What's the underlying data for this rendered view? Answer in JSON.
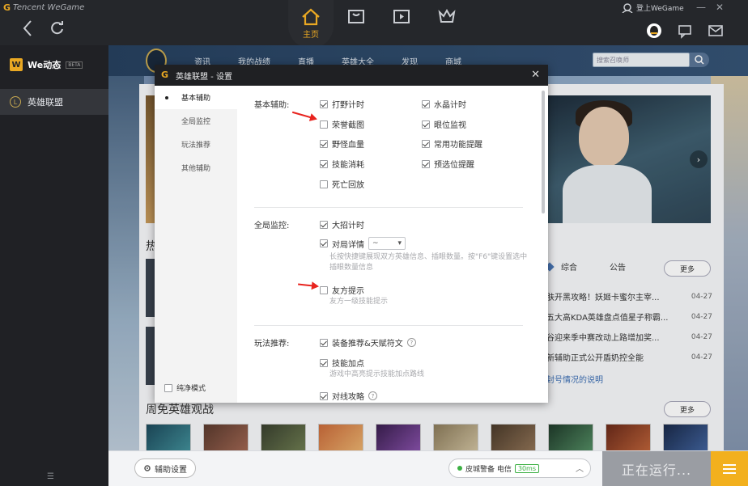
{
  "app": {
    "brand_text": "Tencent WeGame",
    "nav_home_label": "主页",
    "login_text": "登上WeGame",
    "win_controls": [
      "—",
      "✕"
    ]
  },
  "sidebar": {
    "we_title": "We动态",
    "we_badge": "BETA",
    "lol_label": "英雄联盟",
    "footer_glyph": "☰"
  },
  "game_page": {
    "tabs": [
      "资讯",
      "我的战绩",
      "直播",
      "英雄大全",
      "发现",
      "商城"
    ],
    "search_placeholder": "搜索召唤师",
    "hot_label": "热",
    "news_tabs": [
      "综合",
      "公告"
    ],
    "more_label": "更多",
    "news": [
      {
        "title": "肤开黑攻略！妖姬卡蜜尔主宰...",
        "date": "04-27"
      },
      {
        "title": "五大高KDA英雄盘点值星子称霸...",
        "date": "04-27"
      },
      {
        "title": "谷迎来季中赛改动上路增加奖...",
        "date": "04-27"
      },
      {
        "title": "新辅助正式公开盾奶控全能",
        "date": "04-27"
      }
    ],
    "news_link": "封号情况的说明",
    "free_heroes_label": "周免英雄观战"
  },
  "bottom_bar": {
    "assist_label": "辅助设置",
    "server_name": "皮城警备 电信",
    "ping": "30ms",
    "running_label": "正在运行..."
  },
  "dialog": {
    "title": "英雄联盟 - 设置",
    "close": "✕",
    "nav": [
      "基本辅助",
      "全局监控",
      "玩法推荐",
      "其他辅助"
    ],
    "pure_mode_label": "纯净模式",
    "basic": {
      "label": "基本辅助:",
      "options": [
        {
          "label": "打野计时",
          "checked": true
        },
        {
          "label": "水晶计时",
          "checked": true
        },
        {
          "label": "荣誉截图",
          "checked": false
        },
        {
          "label": "眼位监视",
          "checked": true
        },
        {
          "label": "野怪血量",
          "checked": true
        },
        {
          "label": "常用功能提醒",
          "checked": true
        },
        {
          "label": "技能消耗",
          "checked": true
        },
        {
          "label": "预选位提醒",
          "checked": true
        },
        {
          "label": "死亡回放",
          "checked": false
        }
      ]
    },
    "global": {
      "label": "全局监控:",
      "ult_timer": {
        "label": "大招计时",
        "checked": true
      },
      "match_detail": {
        "label": "对局详情",
        "checked": true,
        "select_value": "~"
      },
      "match_hint": "长按快捷键展现双方英雄信息、插眼数量。按\"F6\"键设置选中插眼数量信息",
      "ally_prompt": {
        "label": "友方提示",
        "checked": false
      },
      "ally_hint": "友方一级技能提示"
    },
    "recommend": {
      "label": "玩法推荐:",
      "gear": {
        "label": "装备推荐&天赋符文",
        "checked": true
      },
      "skill": {
        "label": "技能加点",
        "checked": true
      },
      "skill_hint": "游戏中高亮提示技能加点路线",
      "lane": {
        "label": "对线攻略",
        "checked": true
      }
    }
  },
  "colors": {
    "accent": "#e9a823",
    "titlebar": "#1f2023",
    "arrow": "#e8231e",
    "running_bg": "#9a9da3",
    "ping_green": "#3cb043"
  }
}
